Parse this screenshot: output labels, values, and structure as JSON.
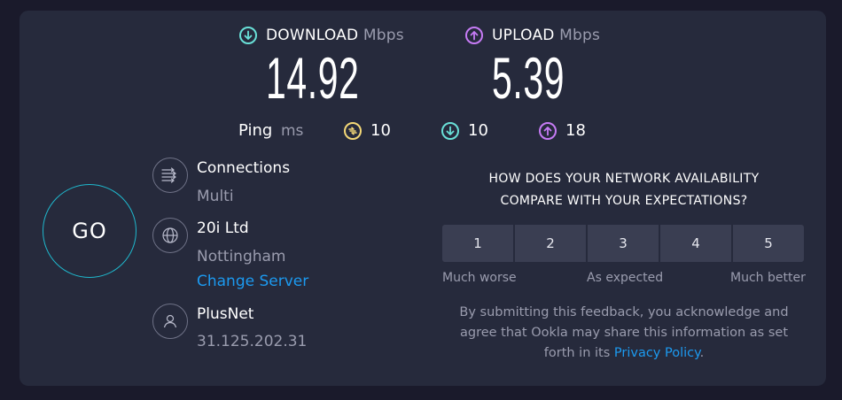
{
  "download": {
    "label": "DOWNLOAD",
    "unit": "Mbps",
    "value": "14.92"
  },
  "upload": {
    "label": "UPLOAD",
    "unit": "Mbps",
    "value": "5.39"
  },
  "ping": {
    "label": "Ping",
    "unit": "ms",
    "idle": "10",
    "download": "10",
    "upload": "18"
  },
  "go_label": "GO",
  "connections": {
    "title": "Connections",
    "value": "Multi"
  },
  "server": {
    "name": "20i Ltd",
    "location": "Nottingham",
    "change_label": "Change Server"
  },
  "provider": {
    "name": "PlusNet",
    "ip": "31.125.202.31"
  },
  "feedback": {
    "question_line1": "HOW DOES YOUR NETWORK AVAILABILITY",
    "question_line2": "COMPARE WITH YOUR EXPECTATIONS?",
    "options": [
      "1",
      "2",
      "3",
      "4",
      "5"
    ],
    "scale_low": "Much worse",
    "scale_mid": "As expected",
    "scale_high": "Much better",
    "disclaimer_line1": "By submitting this feedback, you acknowledge and",
    "disclaimer_line2": "agree that Ookla may share this information as set",
    "disclaimer_line3_prefix": "forth in its",
    "privacy_link": "Privacy Policy",
    "disclaimer_line3_suffix": "."
  },
  "colors": {
    "download_accent": "#69e0d8",
    "upload_accent": "#c67bf5",
    "idle_accent": "#f4d877",
    "go_ring": "#1fb8cd",
    "link": "#1c9af0",
    "card_bg": "#262a3c",
    "page_bg": "#1a1a2b"
  },
  "icons": {
    "download": "arrow-down-circle-icon",
    "upload": "arrow-up-circle-icon",
    "idle": "idle-latency-icon",
    "connections": "connections-icon",
    "server": "globe-icon",
    "provider": "person-icon"
  }
}
